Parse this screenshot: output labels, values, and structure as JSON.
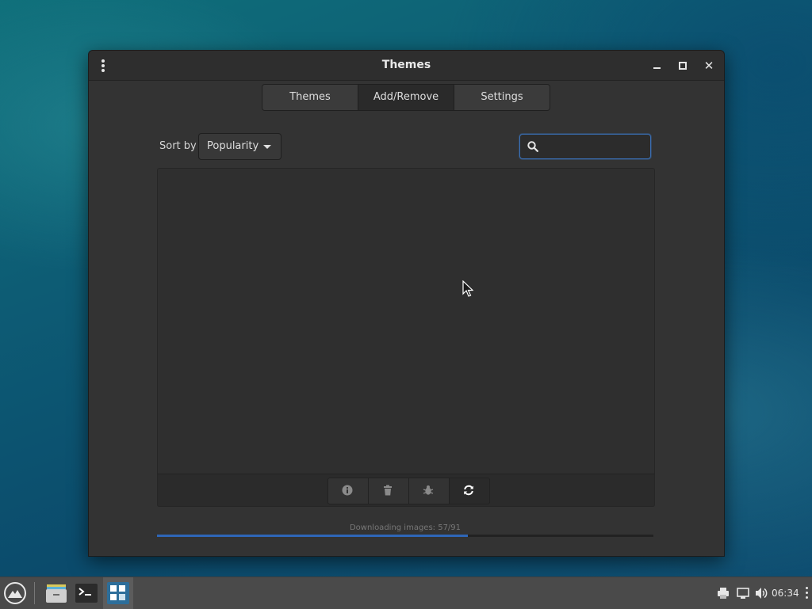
{
  "window": {
    "title": "Themes"
  },
  "tabs": [
    {
      "label": "Themes",
      "active": false
    },
    {
      "label": "Add/Remove",
      "active": true
    },
    {
      "label": "Settings",
      "active": false
    }
  ],
  "sort": {
    "label": "Sort by",
    "selected": "Popularity"
  },
  "search": {
    "value": "",
    "placeholder": "",
    "icon": "search-icon"
  },
  "list_toolbar": {
    "buttons": [
      "info-icon",
      "trash-icon",
      "bug-icon",
      "refresh-icon"
    ]
  },
  "progress": {
    "text": "Downloading images: 57/91",
    "current": 57,
    "total": 91
  },
  "taskbar": {
    "apps": [
      "launcher-icon",
      "file-manager-icon",
      "terminal-icon",
      "themes-app-icon"
    ],
    "tray": [
      "printer-icon",
      "network-icon",
      "volume-icon"
    ],
    "clock": "06:34"
  },
  "colors": {
    "accent": "#2e66b8",
    "window_bg": "#333333"
  }
}
